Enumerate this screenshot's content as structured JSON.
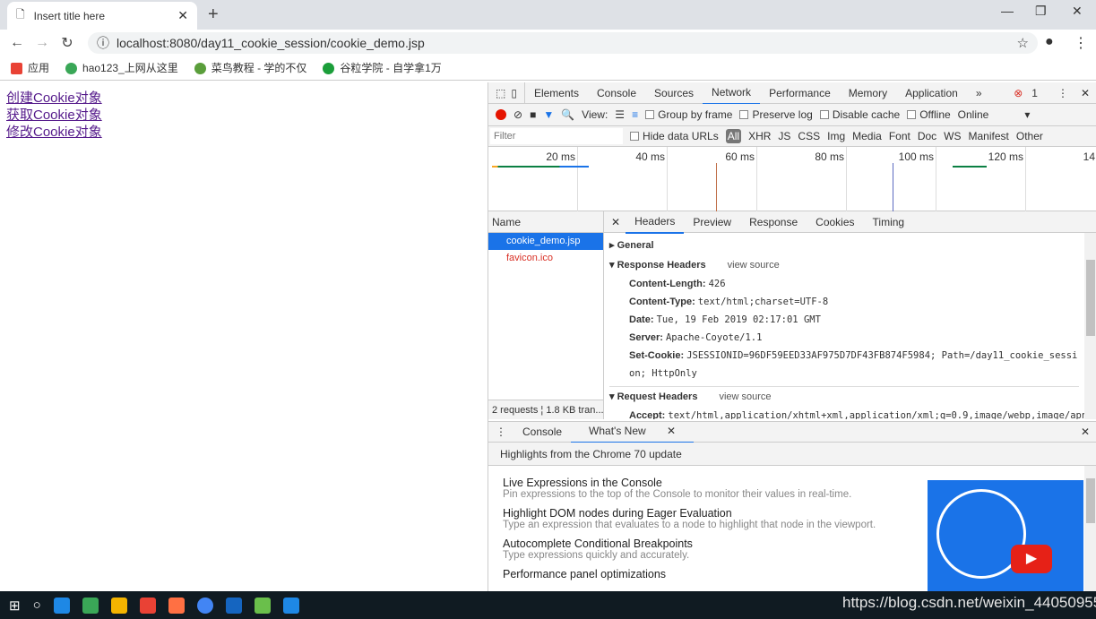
{
  "browser": {
    "tab_title": "Insert title here",
    "url": "localhost:8080/day11_cookie_session/cookie_demo.jsp",
    "bookmarks": [
      {
        "label": "应用",
        "color": "#e94235"
      },
      {
        "label": "hao123_上网从这里",
        "color": "#3aa757"
      },
      {
        "label": "菜鸟教程 - 学的不仅",
        "color": "#5a9e3b"
      },
      {
        "label": "谷粒学院 - 自学拿1万",
        "color": "#1b9e3a"
      }
    ]
  },
  "page": {
    "links": [
      "创建Cookie对象",
      "获取Cookie对象",
      "修改Cookie对象"
    ]
  },
  "devtools": {
    "tabs": [
      "Elements",
      "Console",
      "Sources",
      "Network",
      "Performance",
      "Memory",
      "Application"
    ],
    "active_tab": "Network",
    "error_count": "1",
    "more": "»",
    "toolbar": {
      "view_label": "View:",
      "group_by_frame": "Group by frame",
      "preserve_log": "Preserve log",
      "disable_cache": "Disable cache",
      "offline": "Offline",
      "throttle": "Online"
    },
    "filter": {
      "placeholder": "Filter",
      "hide_data_urls": "Hide data URLs",
      "types": [
        "All",
        "XHR",
        "JS",
        "CSS",
        "Img",
        "Media",
        "Font",
        "Doc",
        "WS",
        "Manifest",
        "Other"
      ]
    },
    "timeline": {
      "ticks": [
        "20 ms",
        "40 ms",
        "60 ms",
        "80 ms",
        "100 ms",
        "120 ms",
        "14"
      ]
    },
    "requests": {
      "header": "Name",
      "items": [
        {
          "name": "cookie_demo.jsp",
          "selected": true
        },
        {
          "name": "favicon.ico",
          "error": true
        }
      ],
      "summary": "2 requests",
      "transferred": "1.8 KB tran..."
    },
    "detail_tabs": [
      "Headers",
      "Preview",
      "Response",
      "Cookies",
      "Timing"
    ],
    "general": "General",
    "response_headers": {
      "title": "Response Headers",
      "view_source": "view source",
      "items": [
        {
          "k": "Content-Length:",
          "v": "426"
        },
        {
          "k": "Content-Type:",
          "v": "text/html;charset=UTF-8"
        },
        {
          "k": "Date:",
          "v": "Tue, 19 Feb 2019 02:17:01 GMT"
        },
        {
          "k": "Server:",
          "v": "Apache-Coyote/1.1"
        },
        {
          "k": "Set-Cookie:",
          "v": "JSESSIONID=96DF59EED33AF975D7DF43FB874F5984; Path=/day11_cookie_session; HttpOnly"
        }
      ]
    },
    "request_headers": {
      "title": "Request Headers",
      "view_source": "view source",
      "items": [
        {
          "k": "Accept:",
          "v": "text/html,application/xhtml+xml,application/xml;q=0.9,image/webp,image/apng,*/"
        }
      ]
    },
    "drawer": {
      "tabs": [
        "Console",
        "What's New"
      ],
      "banner": "Highlights from the Chrome 70 update",
      "items": [
        {
          "title": "Live Expressions in the Console",
          "desc": "Pin expressions to the top of the Console to monitor their values in real-time."
        },
        {
          "title": "Highlight DOM nodes during Eager Evaluation",
          "desc": "Type an expression that evaluates to a node to highlight that node in the viewport."
        },
        {
          "title": "Autocomplete Conditional Breakpoints",
          "desc": "Type expressions quickly and accurately."
        },
        {
          "title": "Performance panel optimizations",
          "desc": ""
        }
      ]
    }
  },
  "watermark": "https://blog.csdn.net/weixin_44050955",
  "colors": {
    "accent": "#1a73e8",
    "selected_row": "#1a73e8",
    "record": "#e51400",
    "taskbar": "#101b22"
  }
}
